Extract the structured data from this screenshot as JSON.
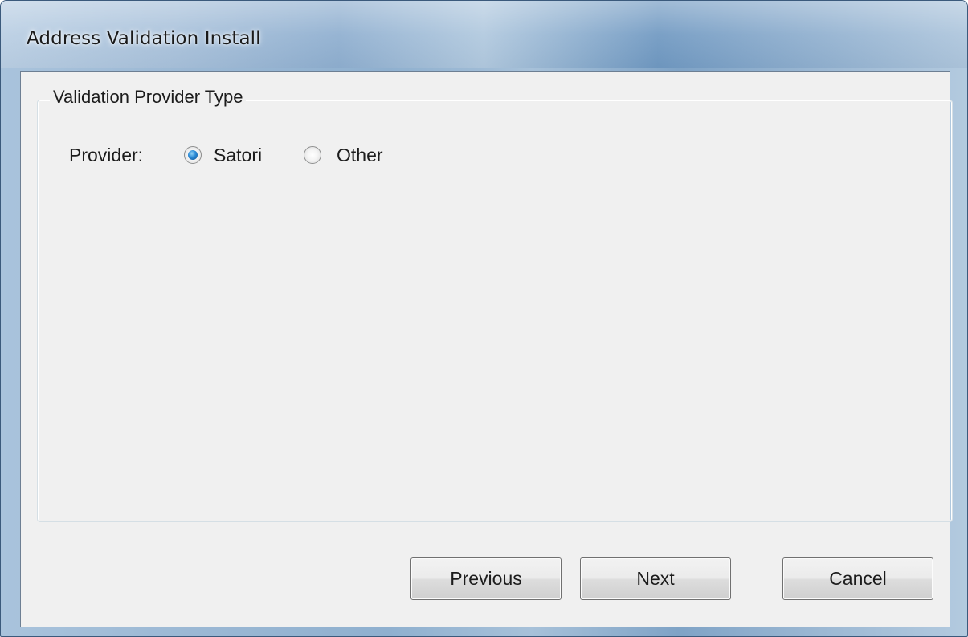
{
  "window": {
    "title": "Address Validation Install"
  },
  "group": {
    "legend": "Validation Provider Type"
  },
  "provider": {
    "label": "Provider:",
    "options": [
      {
        "label": "Satori",
        "checked": true
      },
      {
        "label": "Other",
        "checked": false
      }
    ]
  },
  "buttons": {
    "previous": "Previous",
    "next": "Next",
    "cancel": "Cancel"
  },
  "colors": {
    "radio_selected": "#2a8ad6",
    "client_background": "#f0f0f0"
  }
}
